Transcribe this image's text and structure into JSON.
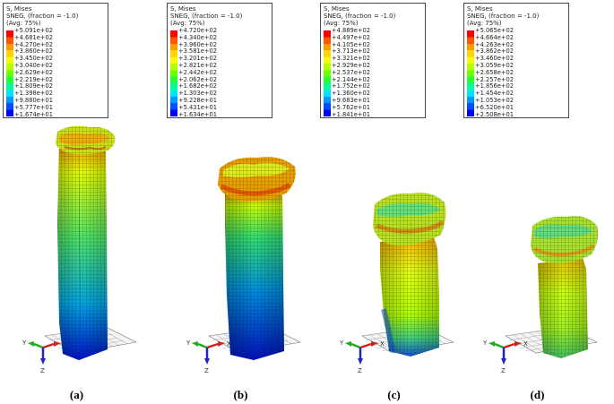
{
  "panels": [
    {
      "legend": {
        "title": "S, Mises",
        "sneg": "SNEG, (fraction = -1.0)",
        "avg": "(Avg: 75%)",
        "values": [
          "+5.091e+02",
          "+4.681e+02",
          "+4.270e+02",
          "+3.860e+02",
          "+3.450e+02",
          "+3.040e+02",
          "+2.629e+02",
          "+2.219e+02",
          "+1.809e+02",
          "+1.398e+02",
          "+9.880e+01",
          "+5.777e+01",
          "+1.674e+01"
        ]
      },
      "caption": "(a)"
    },
    {
      "legend": {
        "title": "S, Mises",
        "sneg": "SNEG, (fraction = -1.0)",
        "avg": "(Avg: 75%)",
        "values": [
          "+4.720e+02",
          "+4.340e+02",
          "+3.960e+02",
          "+3.581e+02",
          "+3.201e+02",
          "+2.821e+02",
          "+2.442e+02",
          "+2.062e+02",
          "+1.682e+02",
          "+1.303e+02",
          "+9.228e+01",
          "+5.431e+01",
          "+1.634e+01"
        ]
      },
      "caption": "(b)"
    },
    {
      "legend": {
        "title": "S, Mises",
        "sneg": "SNEG, (fraction = -1.0)",
        "avg": "(Avg: 75%)",
        "values": [
          "+4.889e+02",
          "+4.497e+02",
          "+4.105e+02",
          "+3.713e+02",
          "+3.321e+02",
          "+2.929e+02",
          "+2.537e+02",
          "+2.144e+02",
          "+1.752e+02",
          "+1.360e+02",
          "+9.683e+01",
          "+5.762e+01",
          "+1.841e+01"
        ]
      },
      "caption": "(c)"
    },
    {
      "legend": {
        "title": "S, Mises",
        "sneg": "SNEG, (fraction = -1.0)",
        "avg": "(Avg: 75%)",
        "values": [
          "+5.065e+02",
          "+4.664e+02",
          "+4.263e+02",
          "+3.862e+02",
          "+3.460e+02",
          "+3.059e+02",
          "+2.658e+02",
          "+2.257e+02",
          "+1.856e+02",
          "+1.454e+02",
          "+1.053e+02",
          "+6.520e+01",
          "+2.508e+01"
        ]
      },
      "caption": "(d)"
    }
  ],
  "triad": {
    "y": "Y",
    "z": "Z",
    "x": "X"
  },
  "colors": {
    "contour_scale": [
      "#ff0000",
      "#ff5500",
      "#ff9a00",
      "#ffd200",
      "#f2ff00",
      "#b4ff00",
      "#6cff00",
      "#22ff37",
      "#00ff9c",
      "#00e2ff",
      "#0099ff",
      "#004fff",
      "#0000ff"
    ],
    "axis_x": "#cc2222",
    "axis_y": "#22aa22",
    "axis_z": "#2222cc"
  }
}
